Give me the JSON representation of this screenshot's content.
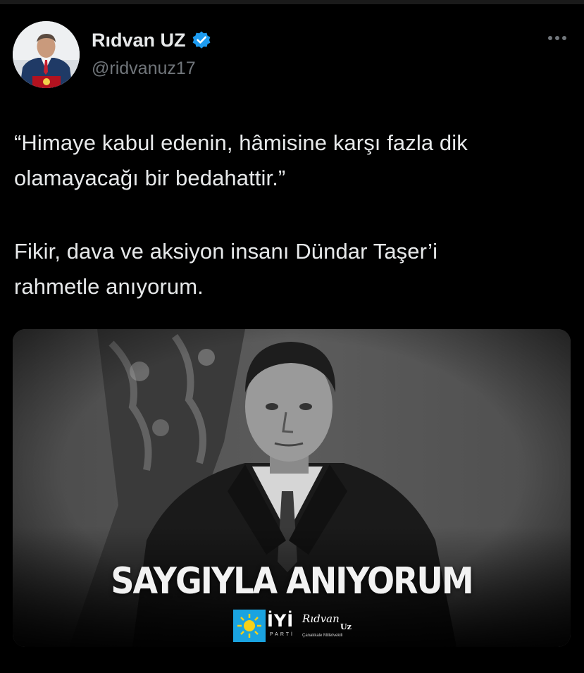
{
  "author": {
    "name": "Rıdvan UZ",
    "handle": "@ridvanuz17",
    "verified_badge_color": "#1d9bf0"
  },
  "tweet": {
    "paragraph1_line1": "“Himaye kabul edenin, hâmisine karşı fazla dik",
    "paragraph1_line2": "olamayacağı bir bedahattir.”",
    "paragraph2_line1": "Fikir, dava ve aksiyon insanı Dündar Taşer’i",
    "paragraph2_line2": "rahmetle anıyorum."
  },
  "media": {
    "title": "SAYGIYLA ANIYORUM",
    "party_logo_text": "İYİ",
    "party_logo_sub": "PARTİ",
    "signature_name": "Rıdvan",
    "signature_surname": "Uz",
    "signature_sub": "Çanakkale Milletvekili"
  },
  "icons": {
    "more": "more-horizontal-icon",
    "verified": "verified-badge-icon"
  }
}
